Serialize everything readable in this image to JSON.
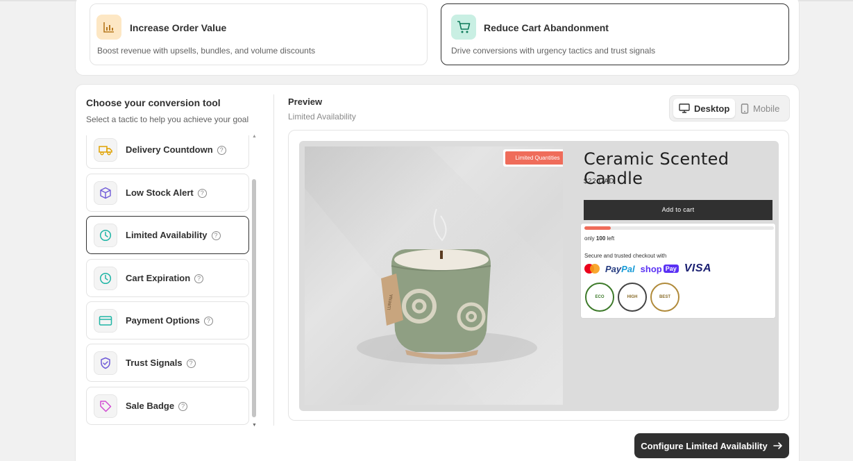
{
  "goals": [
    {
      "title": "Increase Order Value",
      "description": "Boost revenue with upsells, bundles, and volume discounts",
      "icon": "bar-chart-icon"
    },
    {
      "title": "Reduce Cart Abandonment",
      "description": "Drive conversions with urgency tactics and trust signals",
      "icon": "cart-icon",
      "selected": true
    }
  ],
  "tools_panel": {
    "title": "Choose your conversion tool",
    "subtitle": "Select a tactic to help you achieve your goal",
    "help_glyph": "?",
    "items": [
      {
        "label": "Delivery Countdown",
        "icon": "truck-icon"
      },
      {
        "label": "Low Stock Alert",
        "icon": "box-icon"
      },
      {
        "label": "Limited Availability",
        "icon": "clock-icon",
        "active": true
      },
      {
        "label": "Cart Expiration",
        "icon": "clock-icon"
      },
      {
        "label": "Payment Options",
        "icon": "credit-card-icon"
      },
      {
        "label": "Trust Signals",
        "icon": "shield-check-icon"
      },
      {
        "label": "Sale Badge",
        "icon": "tag-icon"
      }
    ]
  },
  "preview": {
    "title": "Preview",
    "subtitle": "Limited Availability",
    "devices": {
      "desktop": "Desktop",
      "mobile": "Mobile"
    },
    "store": {
      "badge": "Limited Quantities",
      "product_title": "Ceramic Scented Candle",
      "price": "$22 CAD",
      "add_to_cart": "Add to cart",
      "stock_prefix": "only",
      "stock_count": "100",
      "stock_suffix": "left",
      "stock_fill_fraction": 0.14,
      "secure_text": "Secure and trusted checkout with",
      "payment_brands": {
        "paypal_a": "Pay",
        "paypal_b": "Pal",
        "shop": "shop",
        "shop_pay": "Pay",
        "visa": "VISA"
      },
      "seals": [
        "ECO",
        "HIGH",
        "BEST"
      ],
      "tag_text": "LUMINA"
    }
  },
  "configure_button": "Configure Limited Availability",
  "colors": {
    "accent_dark": "#303030",
    "badge_red": "#ef6c5a",
    "teal": "#1fb5a5",
    "purple": "#6f5bd8",
    "pink": "#d14ad1"
  }
}
